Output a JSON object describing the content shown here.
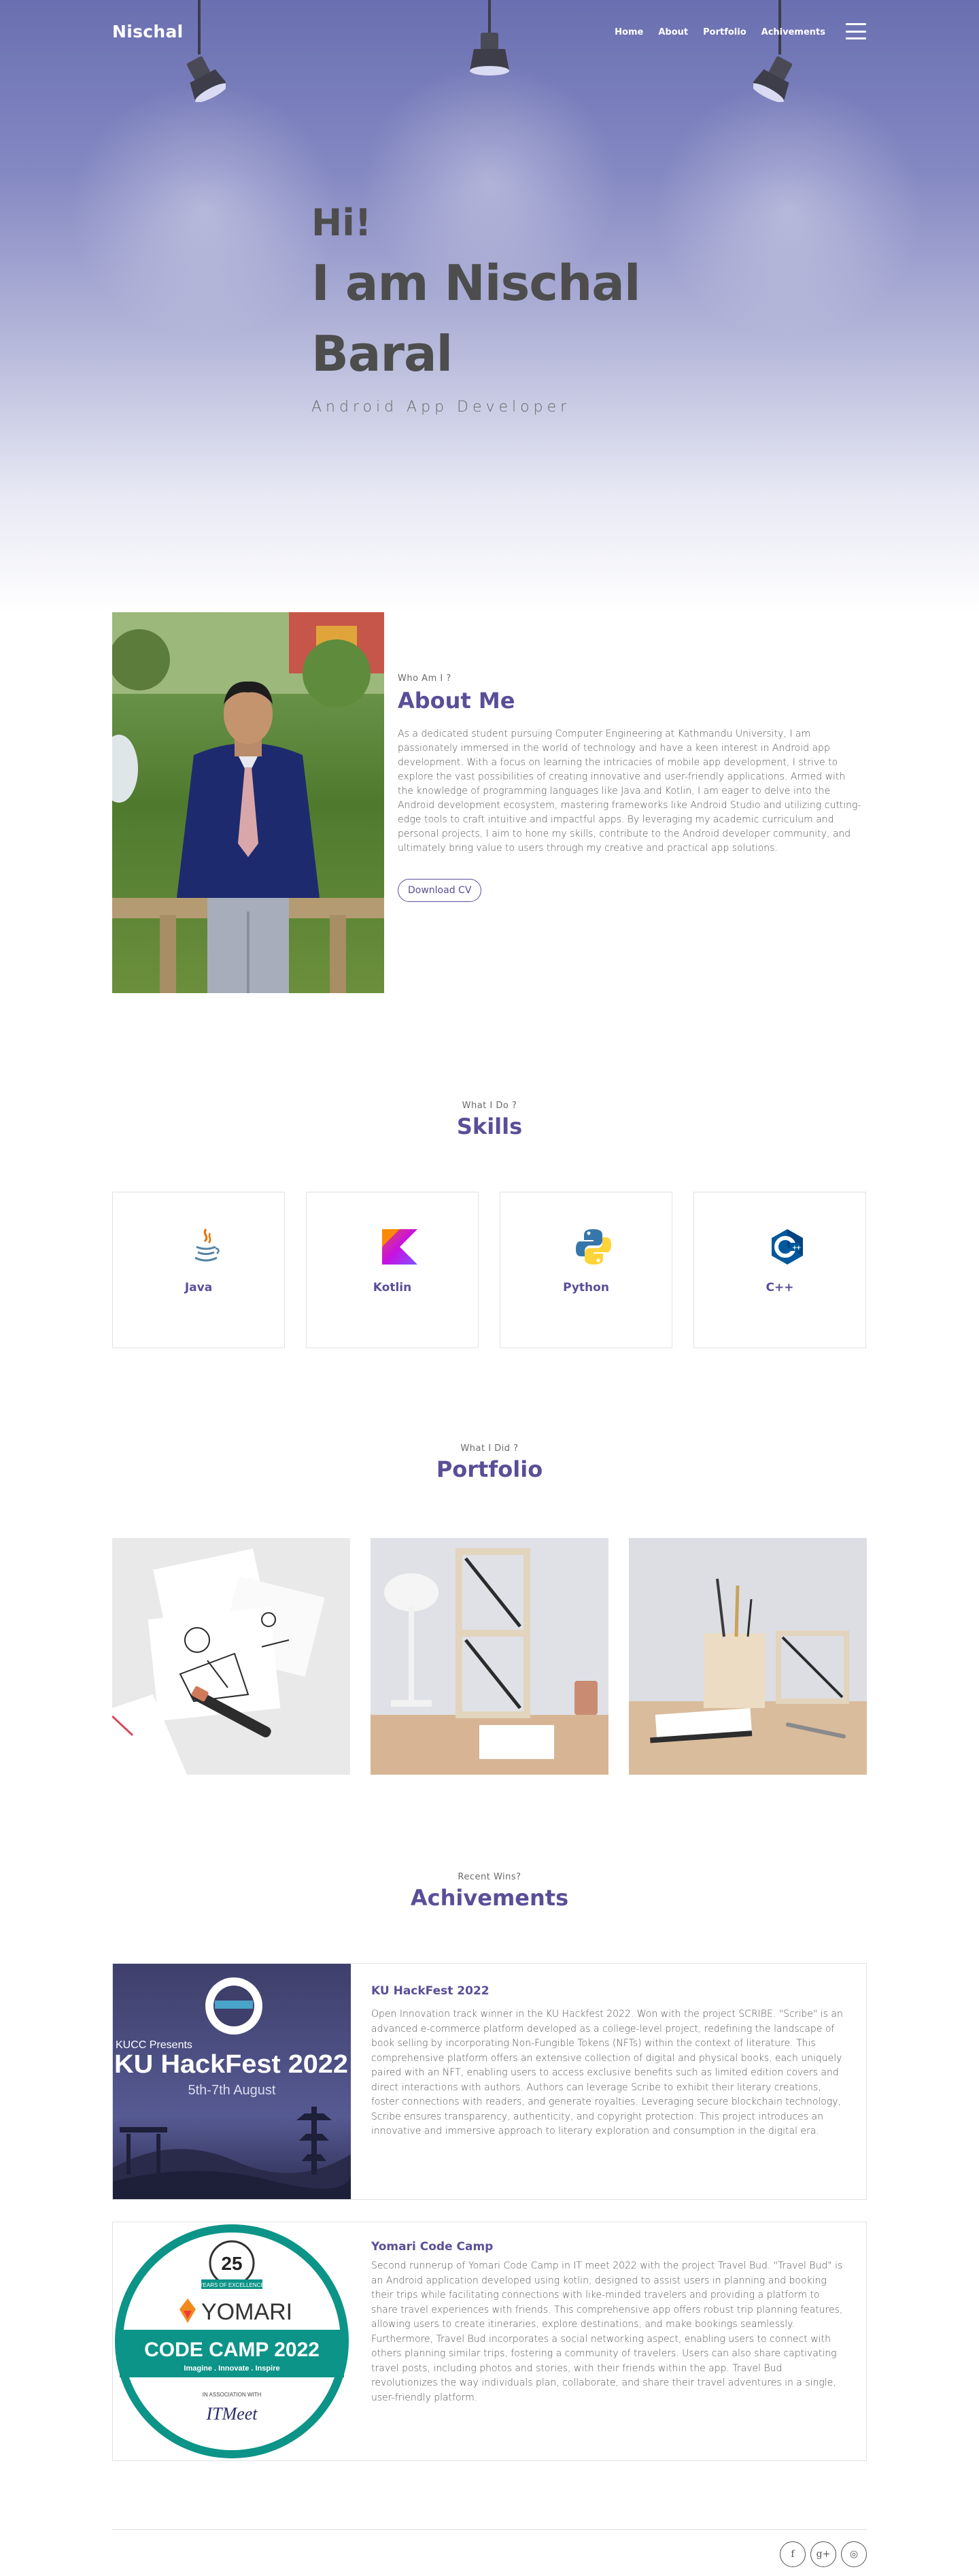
{
  "header": {
    "brand": "Nischal",
    "nav": [
      "Home",
      "About",
      "Portfolio",
      "Achivements"
    ],
    "menu_icon": "hamburger-menu-icon"
  },
  "hero": {
    "greeting": "Hi!",
    "name_line": "I am Nischal Baral",
    "role": "Android App Developer"
  },
  "about": {
    "kicker": "Who Am I ?",
    "title": "About Me",
    "body": "As a dedicated student pursuing Computer Engineering at Kathmandu University, I am passionately immersed in the world of technology and have a keen interest in Android app development. With a focus on learning the intricacies of mobile app development, I strive to explore the vast possibilities of creating innovative and user-friendly applications. Armed with the knowledge of programming languages like Java and Kotlin, I am eager to delve into the Android development ecosystem, mastering frameworks like Android Studio and utilizing cutting-edge tools to craft intuitive and impactful apps. By leveraging my academic curriculum and personal projects, I aim to hone my skills, contribute to the Android developer community, and ultimately bring value to users through my creative and practical app solutions.",
    "cv_button": "Download CV"
  },
  "skills": {
    "kicker": "What I Do ?",
    "title": "Skills",
    "items": [
      {
        "label": "Java",
        "icon": "java-icon"
      },
      {
        "label": "Kotlin",
        "icon": "kotlin-icon"
      },
      {
        "label": "Python",
        "icon": "python-icon"
      },
      {
        "label": "C++",
        "icon": "cpp-icon"
      }
    ]
  },
  "portfolio": {
    "kicker": "What I Did ?",
    "title": "Portfolio"
  },
  "achievements": {
    "kicker": "Recent Wins?",
    "title": "Achivements",
    "items": [
      {
        "title": "KU HackFest 2022",
        "body": "Open Innovation track winner in the KU Hackfest 2022. Won with the project SCRIBE. \"Scribe\" is an advanced e-commerce platform developed as a college-level project, redefining the landscape of book selling by incorporating Non-Fungible Tokens (NFTs) within the context of literature. This comprehensive platform offers an extensive collection of digital and physical books, each uniquely paired with an NFT, enabling users to access exclusive benefits such as limited edition covers and direct interactions with authors. Authors can leverage Scribe to exhibit their literary creations, foster connections with readers, and generate royalties. Leveraging secure blockchain technology, Scribe ensures transparency, authenticity, and copyright protection. This project introduces an innovative and immersive approach to literary exploration and consumption in the digital era.",
        "image": {
          "presents": "KUCC Presents",
          "event": "KU HackFest 2022",
          "dates": "5th-7th August"
        }
      },
      {
        "title": "Yomari Code Camp",
        "body": "Second runnerup of Yomari Code Camp in IT meet 2022 with the project Travel Bud. \"Travel Bud\" is an Android application developed using kotlin, designed to assist users in planning and booking their trips while facilitating connections with like-minded travelers and providing a platform to share travel experiences with friends. This comprehensive app offers robust trip planning features, allowing users to create itineraries, explore destinations, and make bookings seamlessly. Furthermore, Travel Bud incorporates a social networking aspect, enabling users to connect with others planning similar trips, fostering a community of travelers. Users can also share captivating travel posts, including photos and stories, with their friends within the app. Travel Bud revolutionizes the way individuals plan, collaborate, and share their travel adventures in a single, user-friendly platform.",
        "image": {
          "years": "25",
          "years_caption": "YEARS OF EXCELLENCE",
          "brand": "YOMARI",
          "event": "CODE CAMP 2022",
          "tagline": "Imagine . Innovate . Inspire",
          "association": "IN ASSOCIATION WITH",
          "partner": "ITMeet"
        }
      }
    ]
  },
  "footer": {
    "social": [
      {
        "glyph": "f",
        "icon": "facebook-icon"
      },
      {
        "glyph": "g+",
        "icon": "google-plus-icon"
      },
      {
        "glyph": "◎",
        "icon": "instagram-icon"
      }
    ]
  },
  "colors": {
    "accent": "#5b4e98",
    "hero_top": "#6a6fb1",
    "text": "#555555"
  }
}
